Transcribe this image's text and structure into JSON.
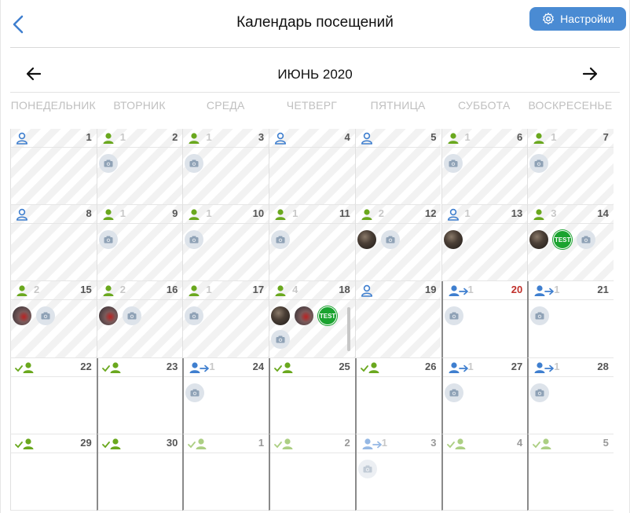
{
  "header": {
    "title": "Календарь посещений",
    "settings_label": "Настройки"
  },
  "month": {
    "title": "ИЮНЬ 2020"
  },
  "weekdays": [
    "ПОНЕДЕЛЬНИК",
    "ВТОРНИК",
    "СРЕДА",
    "ЧЕТВЕРГ",
    "ПЯТНИЦА",
    "СУББОТА",
    "ВОСКРЕСЕНЬЕ"
  ],
  "colors": {
    "accent": "#4a8bd3",
    "green": "#6aa81e",
    "blue": "#3f7fcf",
    "today_red": "#c0302b",
    "test_badge": "#1aa32f"
  },
  "days": [
    {
      "num": "1",
      "icon": "user-outline-blue",
      "count": "",
      "past": true,
      "pics": []
    },
    {
      "num": "2",
      "icon": "user-green",
      "count": "1",
      "past": true,
      "pics": [
        "camera"
      ]
    },
    {
      "num": "3",
      "icon": "user-green",
      "count": "1",
      "past": true,
      "pics": [
        "camera"
      ]
    },
    {
      "num": "4",
      "icon": "user-outline-blue",
      "count": "",
      "past": true,
      "pics": []
    },
    {
      "num": "5",
      "icon": "user-outline-blue",
      "count": "",
      "past": true,
      "pics": []
    },
    {
      "num": "6",
      "icon": "user-green",
      "count": "1",
      "past": true,
      "pics": [
        "camera"
      ]
    },
    {
      "num": "7",
      "icon": "user-green",
      "count": "1",
      "past": true,
      "pics": [
        "camera"
      ]
    },
    {
      "num": "8",
      "icon": "user-outline-blue",
      "count": "",
      "past": true,
      "pics": []
    },
    {
      "num": "9",
      "icon": "user-green",
      "count": "1",
      "past": true,
      "pics": [
        "camera"
      ]
    },
    {
      "num": "10",
      "icon": "user-green",
      "count": "1",
      "past": true,
      "pics": [
        "camera"
      ]
    },
    {
      "num": "11",
      "icon": "user-green",
      "count": "1",
      "past": true,
      "pics": [
        "camera"
      ]
    },
    {
      "num": "12",
      "icon": "user-green",
      "count": "2",
      "past": true,
      "pics": [
        "photo",
        "camera"
      ]
    },
    {
      "num": "13",
      "icon": "user-outline-blue",
      "count": "1",
      "past": true,
      "pics": [
        "photo"
      ]
    },
    {
      "num": "14",
      "icon": "user-green",
      "count": "3",
      "past": true,
      "pics": [
        "photo",
        "test",
        "camera"
      ]
    },
    {
      "num": "15",
      "icon": "user-green",
      "count": "2",
      "past": true,
      "pics": [
        "car",
        "camera"
      ]
    },
    {
      "num": "16",
      "icon": "user-green",
      "count": "2",
      "past": true,
      "pics": [
        "car",
        "camera"
      ]
    },
    {
      "num": "17",
      "icon": "user-green",
      "count": "1",
      "past": true,
      "pics": [
        "camera"
      ]
    },
    {
      "num": "18",
      "icon": "user-green",
      "count": "4",
      "past": true,
      "pics": [
        "photo",
        "car",
        "test",
        "camera"
      ]
    },
    {
      "num": "19",
      "icon": "user-outline-blue",
      "count": "",
      "past": true,
      "pics": []
    },
    {
      "num": "20",
      "icon": "user-arrow-blue",
      "count": "1",
      "past": false,
      "today": true,
      "pics": [
        "camera"
      ]
    },
    {
      "num": "21",
      "icon": "user-arrow-blue",
      "count": "1",
      "past": false,
      "pics": [
        "camera"
      ]
    },
    {
      "num": "22",
      "icon": "user-check-green",
      "count": "",
      "past": false,
      "pics": []
    },
    {
      "num": "23",
      "icon": "user-check-green",
      "count": "",
      "past": false,
      "pics": []
    },
    {
      "num": "24",
      "icon": "user-arrow-blue",
      "count": "1",
      "past": false,
      "pics": [
        "camera"
      ]
    },
    {
      "num": "25",
      "icon": "user-check-green",
      "count": "",
      "past": false,
      "pics": []
    },
    {
      "num": "26",
      "icon": "user-check-green",
      "count": "",
      "past": false,
      "pics": []
    },
    {
      "num": "27",
      "icon": "user-arrow-blue",
      "count": "1",
      "past": false,
      "pics": [
        "camera"
      ]
    },
    {
      "num": "28",
      "icon": "user-arrow-blue",
      "count": "1",
      "past": false,
      "pics": [
        "camera"
      ]
    },
    {
      "num": "29",
      "icon": "user-check-green",
      "count": "",
      "past": false,
      "pics": []
    },
    {
      "num": "30",
      "icon": "user-check-green",
      "count": "",
      "past": false,
      "pics": []
    },
    {
      "num": "1",
      "icon": "user-check-green",
      "count": "",
      "past": false,
      "other": true,
      "pics": []
    },
    {
      "num": "2",
      "icon": "user-check-green",
      "count": "",
      "past": false,
      "other": true,
      "pics": []
    },
    {
      "num": "3",
      "icon": "user-arrow-blue",
      "count": "1",
      "past": false,
      "other": true,
      "pics": [
        "camera"
      ]
    },
    {
      "num": "4",
      "icon": "user-check-green",
      "count": "",
      "past": false,
      "other": true,
      "pics": []
    },
    {
      "num": "5",
      "icon": "user-check-green",
      "count": "",
      "past": false,
      "other": true,
      "pics": []
    }
  ],
  "badge_test_label": "TEST"
}
